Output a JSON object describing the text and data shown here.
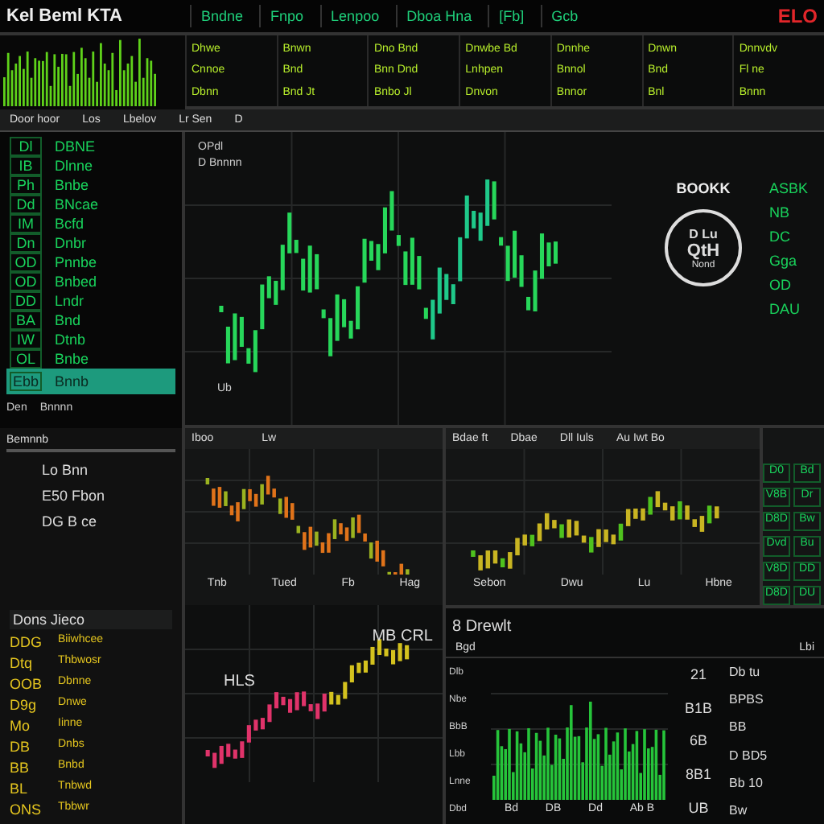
{
  "header": {
    "title": "Kel Beml KTA",
    "tabs": [
      "Bndne",
      "Fnpo",
      "Lenpoo",
      "Dboa Hna",
      "[Fb]",
      "Gcb"
    ],
    "alert": "ELO"
  },
  "tickers": [
    {
      "lines": [
        "Dhwe",
        "Cnnoe",
        "Dbnn"
      ]
    },
    {
      "lines": [
        "Bnwn",
        "Bnd",
        "Bnd Jt"
      ]
    },
    {
      "lines": [
        "Dno Bnd",
        "Bnn Dnd",
        "Bnbo Jl"
      ]
    },
    {
      "lines": [
        "Dnwbe Bd",
        "Lnhpen",
        "Dnvon"
      ]
    },
    {
      "lines": [
        "Dnnhe",
        "Bnnol",
        "Bnnor"
      ]
    },
    {
      "lines": [
        "Dnwn",
        "Bnd",
        "Bnl"
      ]
    },
    {
      "lines": [
        "Dnnvdv",
        "Fl ne",
        "Bnnn"
      ]
    }
  ],
  "toolbar": [
    "Door hoor",
    "Los",
    "Lbelov",
    "Lr Sen",
    "D"
  ],
  "watchlist": {
    "items": [
      {
        "code": "Dl",
        "name": "DBNE",
        "selected": false
      },
      {
        "code": "IB",
        "name": "Dlnne",
        "selected": false
      },
      {
        "code": "Ph",
        "name": "Bnbe",
        "selected": false
      },
      {
        "code": "Dd",
        "name": "BNcae",
        "selected": false
      },
      {
        "code": "IM",
        "name": "Bcfd",
        "selected": false
      },
      {
        "code": "Dn",
        "name": "Dnbr",
        "selected": false
      },
      {
        "code": "OD",
        "name": "Pnnbe",
        "selected": false
      },
      {
        "code": "OD",
        "name": "Bnbed",
        "selected": false
      },
      {
        "code": "DD",
        "name": "Lndr",
        "selected": false
      },
      {
        "code": "BA",
        "name": "Bnd",
        "selected": false
      },
      {
        "code": "IW",
        "name": "Dtnb",
        "selected": false
      },
      {
        "code": "OL",
        "name": "Bnbe",
        "selected": false
      },
      {
        "code": "Ebb",
        "name": "Bnnb",
        "selected": true
      }
    ],
    "footer": [
      "Den",
      "Bnnnn"
    ]
  },
  "main_chart": {
    "labels": [
      "OPdl",
      "D Bnnnn"
    ],
    "axis_label": "Ub",
    "book": "BOOKK",
    "badge": [
      "D Lu",
      "QtH",
      "Nond"
    ],
    "side": [
      "ASBK",
      "NB",
      "DC",
      "Gga",
      "OD",
      "DAU"
    ]
  },
  "info_panel": {
    "title": "Bemnnb",
    "lines": [
      "Lo Bnn",
      "E50 Fbon",
      "DG B ce"
    ]
  },
  "chart_a": {
    "title": "Iboo",
    "tag": "Lw",
    "x_labels": [
      "Tnb",
      "Tued",
      "Fb",
      "Hag"
    ]
  },
  "chart_b": {
    "title": "Bdae ft",
    "tag": "Dbae",
    "extra": [
      "Dll Iuls",
      "Au Iwt Bo"
    ],
    "x_labels": [
      "Sebon",
      "Dwu",
      "Lu",
      "Hbne"
    ]
  },
  "quotes": [
    "D0",
    "Bd",
    "V8B",
    "Dr",
    "D8D",
    "Bw",
    "Dvd",
    "Bu",
    "V8D",
    "DD",
    "D8D",
    "DU"
  ],
  "movers": {
    "title": "Dons Jieco",
    "items": [
      {
        "code": "DDG",
        "name": "Biiwhcee"
      },
      {
        "code": "Dtq",
        "name": "Thbwosr"
      },
      {
        "code": "OOB",
        "name": "Dbnne"
      },
      {
        "code": "D9g",
        "name": "Dnwe"
      },
      {
        "code": "Mo",
        "name": "Iinne"
      },
      {
        "code": "DB",
        "name": "Dnbs"
      },
      {
        "code": "BB",
        "name": "Bnbd"
      },
      {
        "code": "BL",
        "name": "Tnbwd"
      },
      {
        "code": "ONS",
        "name": "Tbbwr"
      }
    ]
  },
  "chart_c": {
    "title": "MB CRL",
    "label": "HLS"
  },
  "depth": {
    "title": "8 Drewlt",
    "left": "Bgd",
    "mid": "Lbi",
    "axis": [
      "Dlb",
      "Nbe",
      "BbB",
      "Lbb",
      "Lnne",
      "Dbd"
    ],
    "x_labels": [
      "Bd",
      "DB",
      "Dd",
      "Ab B"
    ],
    "codes": [
      "21",
      "B1B",
      "6B",
      "8B1",
      "UB"
    ],
    "values": [
      "Db tu",
      "BPBS",
      "BB",
      "D BD5",
      "Bb 10",
      "Bw"
    ]
  }
}
